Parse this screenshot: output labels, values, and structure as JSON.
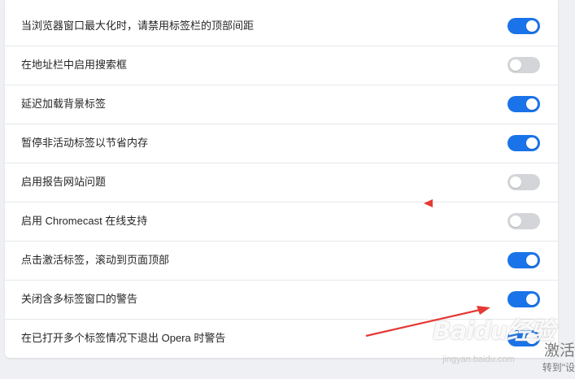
{
  "settings": {
    "items": [
      {
        "label": "当浏览器窗口最大化时，请禁用标签栏的顶部间距",
        "enabled": true
      },
      {
        "label": "在地址栏中启用搜索框",
        "enabled": false
      },
      {
        "label": "延迟加载背景标签",
        "enabled": true
      },
      {
        "label": "暂停非活动标签以节省内存",
        "enabled": true
      },
      {
        "label": "启用报告网站问题",
        "enabled": false
      },
      {
        "label": "启用 Chromecast 在线支持",
        "enabled": false
      },
      {
        "label": "点击激活标签，滚动到页面顶部",
        "enabled": true
      },
      {
        "label": "关闭含多标签窗口的警告",
        "enabled": true
      },
      {
        "label": "在已打开多个标签情况下退出 Opera 时警告",
        "enabled": true
      }
    ]
  },
  "watermark": {
    "logo_text": "Baidu经验",
    "url_text": "jingyan.baidu.com"
  },
  "activation": {
    "title": "激活",
    "subtitle": "转到\"设"
  },
  "colors": {
    "toggle_on": "#1a73e8",
    "toggle_off": "#d4d5d9",
    "annotation_arrow": "#e53935"
  },
  "icons": {
    "annotation": "red-arrow-icon",
    "pointer": "red-triangle-icon"
  }
}
